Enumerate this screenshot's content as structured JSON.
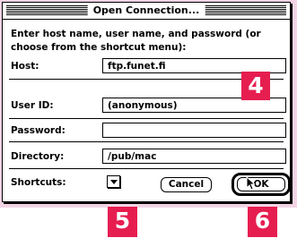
{
  "window": {
    "title": "Open Connection..."
  },
  "prompt": "Enter host name, user name, and password (or choose from the shortcut menu):",
  "fields": {
    "host": {
      "label": "Host:",
      "value": "ftp.funet.fi"
    },
    "user_id": {
      "label": "User ID:",
      "value": "(anonymous)"
    },
    "password": {
      "label": "Password:",
      "value": ""
    },
    "directory": {
      "label": "Directory:",
      "value": "/pub/mac"
    }
  },
  "shortcuts": {
    "label": "Shortcuts:"
  },
  "buttons": {
    "cancel": "Cancel",
    "ok": "OK"
  },
  "callouts": {
    "c4": "4",
    "c5": "5",
    "c6": "6"
  },
  "colors": {
    "callout": "#e61e50",
    "background_band": "#f2d4e4"
  }
}
